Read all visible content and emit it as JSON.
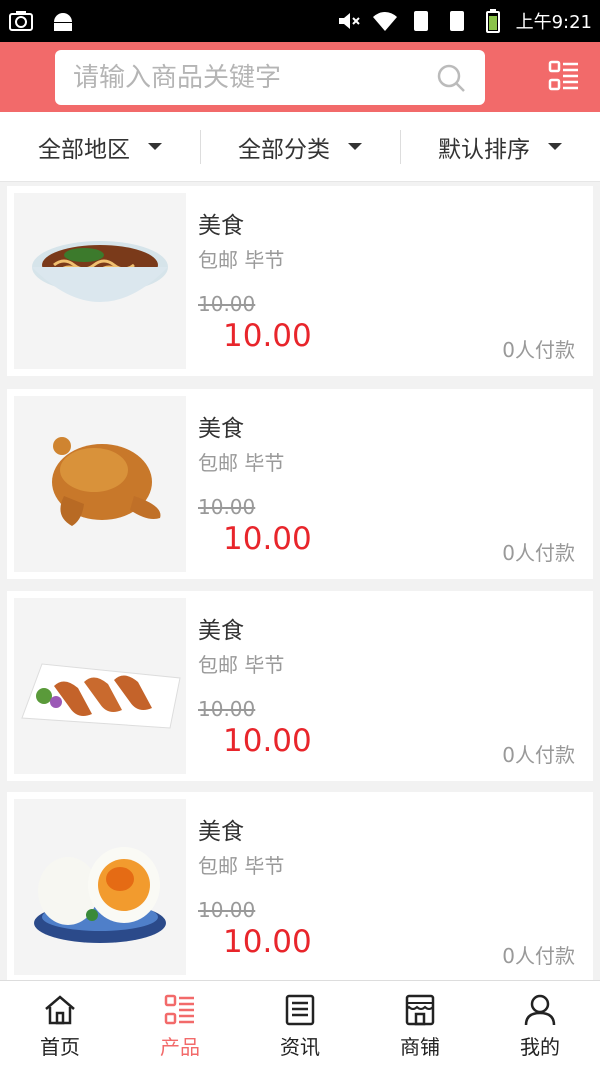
{
  "status_bar": {
    "time": "上午9:21",
    "icons": [
      "camera-icon",
      "android-icon",
      "mute-icon",
      "wifi-icon",
      "sim1-icon",
      "sim2-icon",
      "battery-icon"
    ]
  },
  "header": {
    "search_placeholder": "请输入商品关键字",
    "search_icon": "search-icon",
    "menu_icon": "category-list-icon",
    "bg_color": "#f26a6a"
  },
  "filters": [
    {
      "label": "全部地区"
    },
    {
      "label": "全部分类"
    },
    {
      "label": "默认排序"
    }
  ],
  "products": [
    {
      "title": "美食",
      "sub": "包邮 毕节",
      "old_price": "10.00",
      "price": "10.00",
      "paid": "0人付款",
      "image": "noodle-bowl"
    },
    {
      "title": "美食",
      "sub": "包邮 毕节",
      "old_price": "10.00",
      "price": "10.00",
      "paid": "0人付款",
      "image": "roast-chicken"
    },
    {
      "title": "美食",
      "sub": "包邮 毕节",
      "old_price": "10.00",
      "price": "10.00",
      "paid": "0人付款",
      "image": "grilled-skewers"
    },
    {
      "title": "美食",
      "sub": "包邮 毕节",
      "old_price": "10.00",
      "price": "10.00",
      "paid": "0人付款",
      "image": "salted-eggs"
    }
  ],
  "tabbar": [
    {
      "label": "首页",
      "icon": "home-icon",
      "active": false
    },
    {
      "label": "产品",
      "icon": "product-list-icon",
      "active": true
    },
    {
      "label": "资讯",
      "icon": "news-icon",
      "active": false
    },
    {
      "label": "商铺",
      "icon": "shop-icon",
      "active": false
    },
    {
      "label": "我的",
      "icon": "user-icon",
      "active": false
    }
  ],
  "colors": {
    "accent": "#f26a6a",
    "price": "#e8252b",
    "muted": "#999999"
  }
}
